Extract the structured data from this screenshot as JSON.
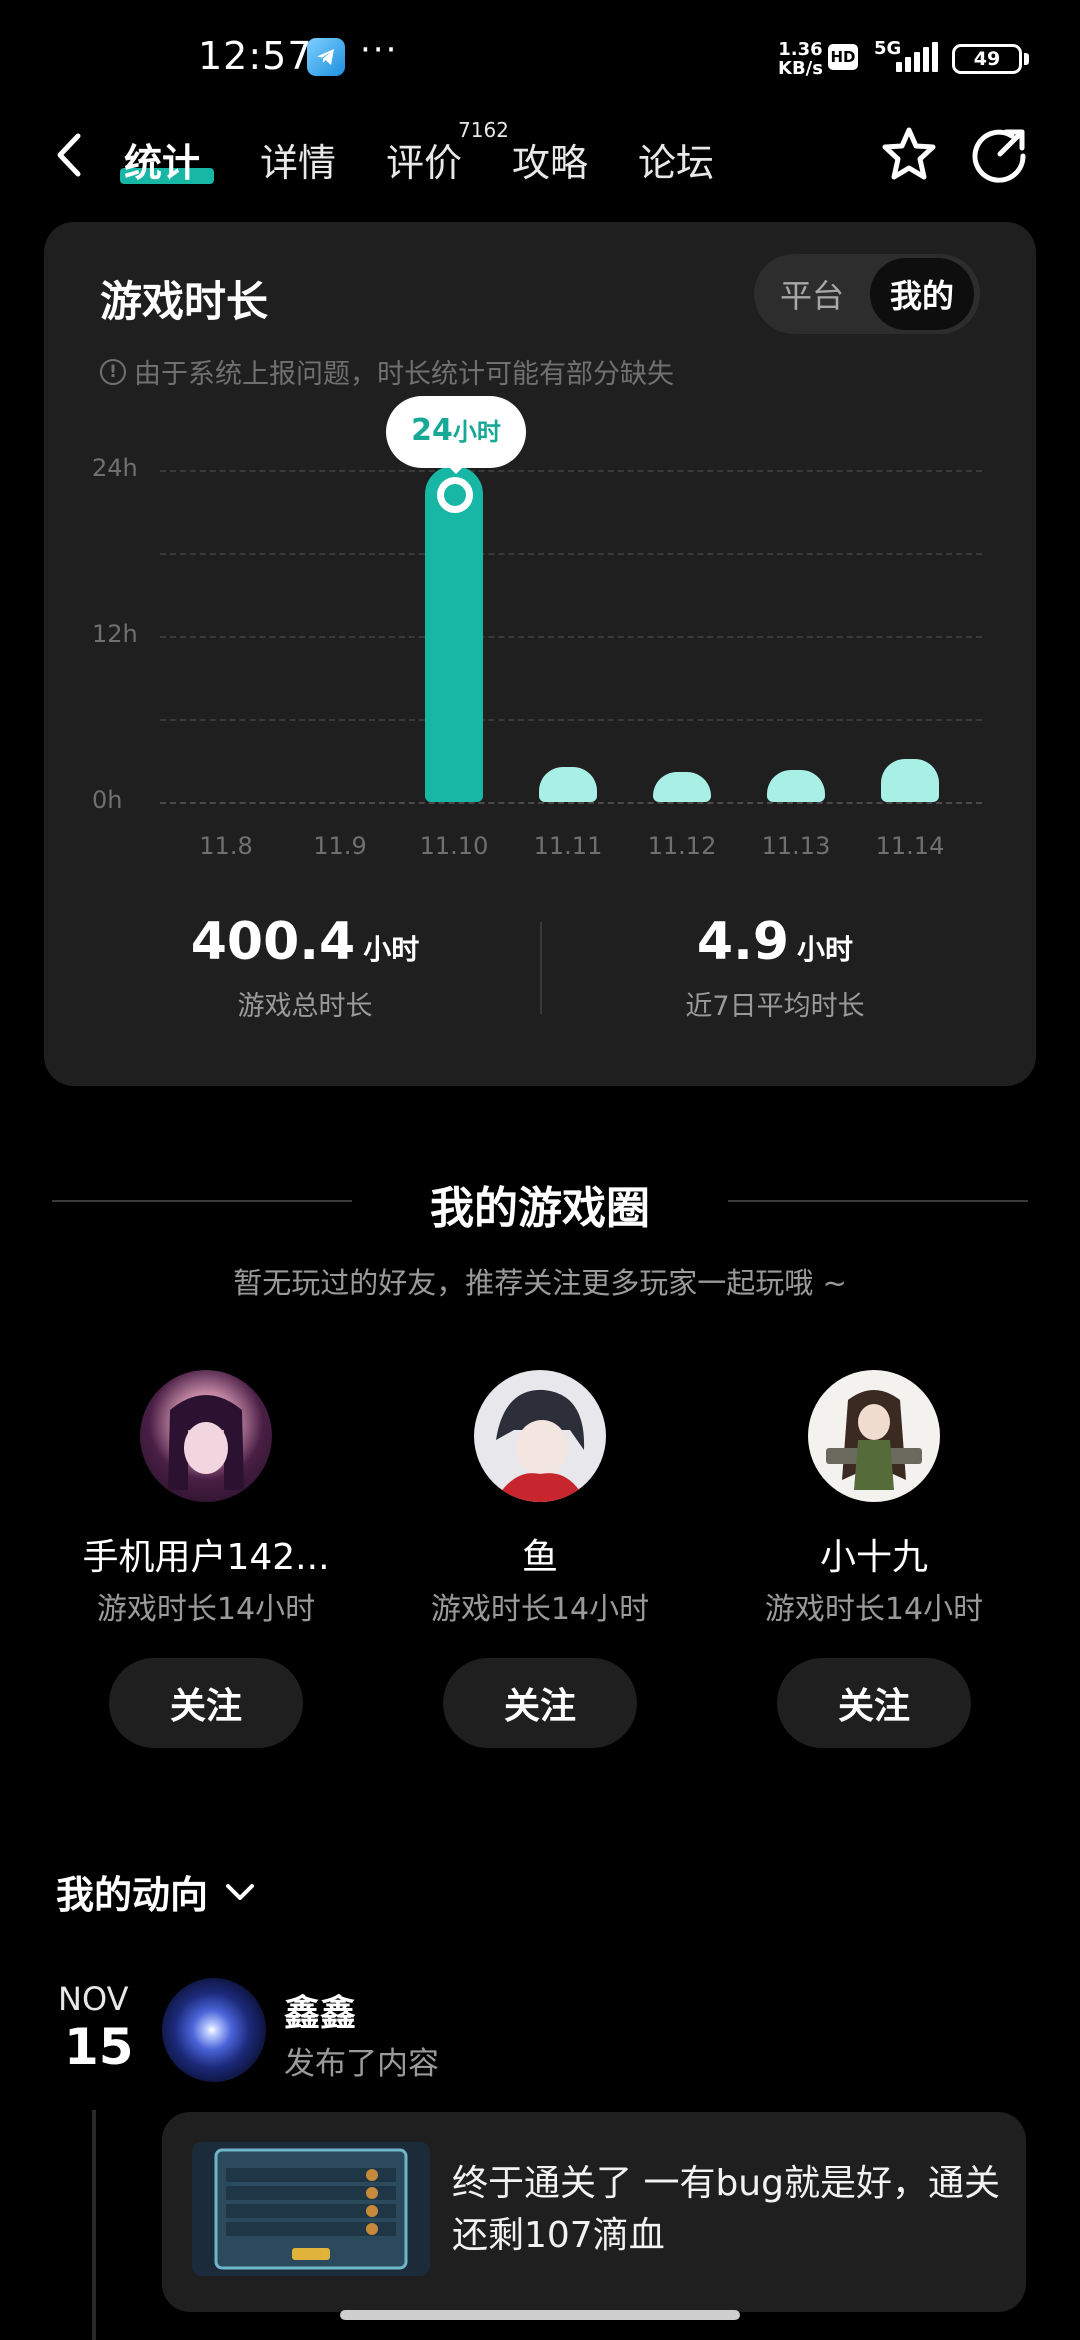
{
  "status_bar": {
    "time": "12:57",
    "more": "···",
    "net_speed_value": "1.36",
    "net_speed_unit": "KB/s",
    "hd": "HD",
    "network": "5G",
    "battery": "49"
  },
  "nav": {
    "tabs": [
      "统计",
      "详情",
      "评价",
      "攻略",
      "论坛"
    ],
    "active_tab": "统计",
    "review_count": "7162"
  },
  "stats_card": {
    "title": "游戏时长",
    "toggle": {
      "platform": "平台",
      "mine": "我的",
      "selected": "我的"
    },
    "notice": "由于系统上报问题，时长统计可能有部分缺失",
    "tooltip": {
      "value": "24",
      "unit": "小时"
    },
    "total": {
      "value": "400.4",
      "unit": "小时",
      "label": "游戏总时长"
    },
    "average": {
      "value": "4.9",
      "unit": "小时",
      "label": "近7日平均时长"
    }
  },
  "chart_data": {
    "type": "bar",
    "categories": [
      "11.8",
      "11.9",
      "11.10",
      "11.11",
      "11.12",
      "11.13",
      "11.14"
    ],
    "values": [
      0,
      0,
      24,
      2.5,
      1.8,
      2.3,
      3.1
    ],
    "ylim": [
      0,
      24
    ],
    "yticks": [
      "0h",
      "12h",
      "24h"
    ],
    "highlight_index": 2,
    "grid": true,
    "colors": {
      "highlight": "#18b6a4",
      "normal": "#a8f0e6"
    }
  },
  "game_circle": {
    "title": "我的游戏圈",
    "subtitle": "暂无玩过的好友，推荐关注更多玩家一起玩哦 ~",
    "friends": [
      {
        "name": "手机用户142...",
        "playtime": "游戏时长14小时",
        "follow": "关注"
      },
      {
        "name": "鱼",
        "playtime": "游戏时长14小时",
        "follow": "关注"
      },
      {
        "name": "小十九",
        "playtime": "游戏时长14小时",
        "follow": "关注"
      }
    ]
  },
  "activity": {
    "title": "我的动向",
    "month": "NOV",
    "day": "15",
    "user": "鑫鑫",
    "action": "发布了内容",
    "post_text": "终于通关了 一有bug就是好，通关还剩107滴血"
  }
}
